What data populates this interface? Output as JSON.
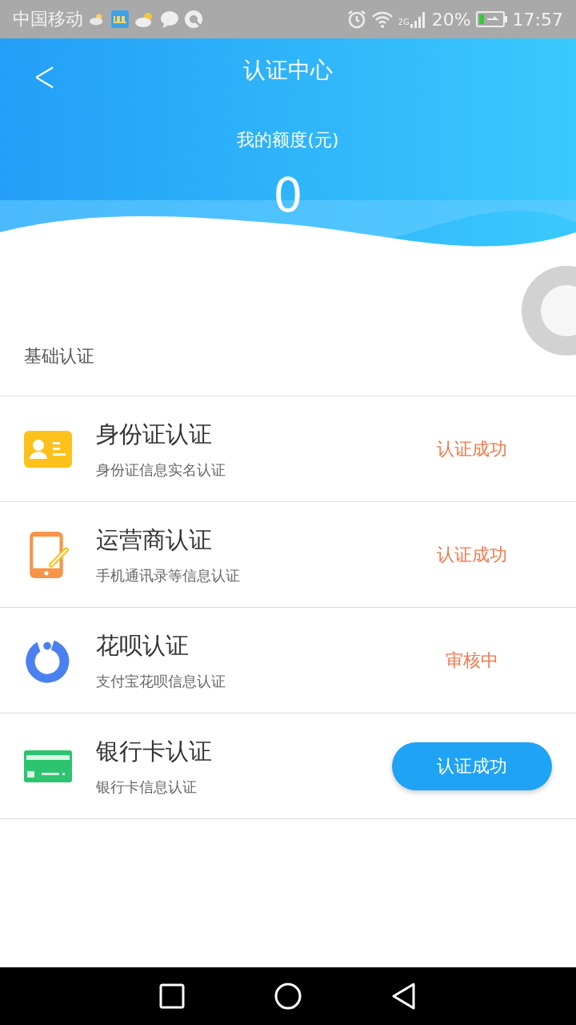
{
  "status_bar": {
    "carrier": "中国移动",
    "network": "2G",
    "battery": "20%",
    "time": "17:57"
  },
  "header": {
    "back": "<",
    "title": "认证中心"
  },
  "quota": {
    "label": "我的额度(元)",
    "value": "0"
  },
  "section": {
    "title": "基础认证"
  },
  "items": [
    {
      "title": "身份证认证",
      "subtitle": "身份证信息实名认证",
      "kind": "status",
      "status": "认证成功"
    },
    {
      "title": "运营商认证",
      "subtitle": "手机通讯录等信息认证",
      "kind": "status",
      "status": "认证成功"
    },
    {
      "title": "花呗认证",
      "subtitle": "支付宝花呗信息认证",
      "kind": "status",
      "status": "审核中"
    },
    {
      "title": "银行卡认证",
      "subtitle": "银行卡信息认证",
      "kind": "button",
      "status": "认证成功"
    }
  ]
}
